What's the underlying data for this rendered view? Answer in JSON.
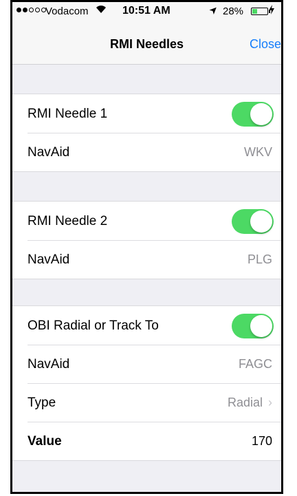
{
  "status_bar": {
    "carrier": "Vodacom",
    "time": "10:51 AM",
    "battery_percent": "28%",
    "signal_bars": 2,
    "battery_level": 0.28,
    "icons": [
      "wifi-icon",
      "location-arrow-icon",
      "battery-icon",
      "charging-bolt-icon"
    ]
  },
  "nav": {
    "title": "RMI Needles",
    "close_label": "Close"
  },
  "sections": {
    "needle1": {
      "toggle_label": "RMI Needle 1",
      "toggle_on": true,
      "navaid_label": "NavAid",
      "navaid_value": "WKV"
    },
    "needle2": {
      "toggle_label": "RMI Needle 2",
      "toggle_on": true,
      "navaid_label": "NavAid",
      "navaid_value": "PLG"
    },
    "obi": {
      "toggle_label": "OBI Radial or Track To",
      "toggle_on": true,
      "navaid_label": "NavAid",
      "navaid_value": "FAGC",
      "type_label": "Type",
      "type_value": "Radial",
      "value_label": "Value",
      "value_value": "170"
    }
  },
  "colors": {
    "accent": "#157efb",
    "toggle_on": "#4cd964",
    "background": "#efeff4",
    "secondary_text": "#8e8e93"
  }
}
